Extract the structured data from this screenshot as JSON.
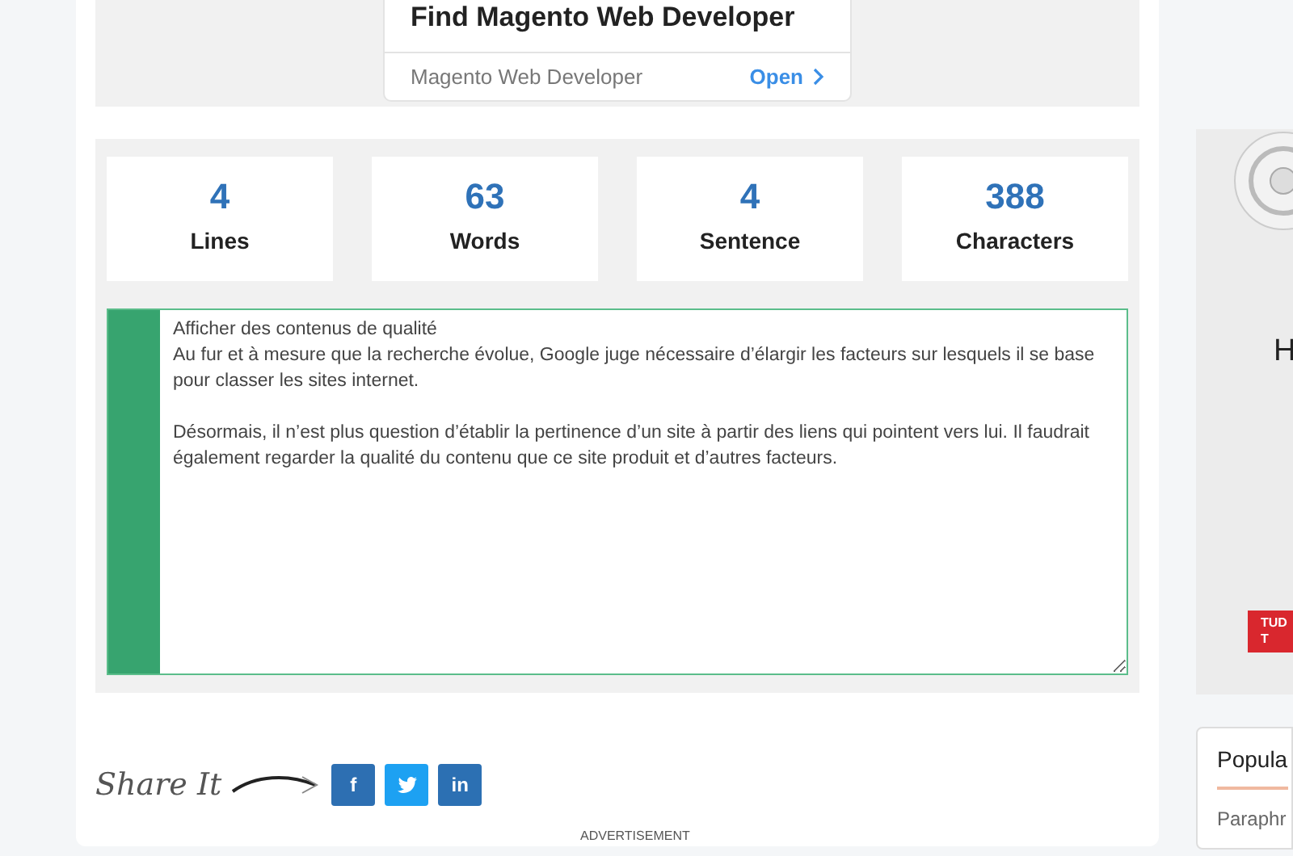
{
  "ad_card": {
    "title": "Find Magento Web Developer",
    "subtitle": "Magento Web Developer",
    "action": "Open"
  },
  "stats": [
    {
      "value": "4",
      "label": "Lines"
    },
    {
      "value": "63",
      "label": "Words"
    },
    {
      "value": "4",
      "label": "Sentence"
    },
    {
      "value": "388",
      "label": "Characters"
    }
  ],
  "editor": {
    "value": "Afficher des contenus de qualité\nAu fur et à mesure que la recherche évolue, Google juge nécessaire d’élargir les facteurs sur lesquels il se base pour classer les sites internet.\n\nDésormais, il n’est plus question d’établir la pertinence d’un site à partir des liens qui pointent vers lui. Il faudrait également regarder la qualité du contenu que ce site produit et d’autres facteurs."
  },
  "share": {
    "label": "Share It",
    "buttons": [
      {
        "kind": "facebook",
        "text": "f",
        "color": "#2d6fb2"
      },
      {
        "kind": "twitter",
        "color": "#1da1f2"
      },
      {
        "kind": "linkedin",
        "text": "in",
        "color": "#2c70b3"
      }
    ]
  },
  "advertisement_label": "ADVERTISEMENT",
  "sidebar": {
    "ad_heading": "H",
    "ad_button": [
      "TUD",
      "T"
    ],
    "popular": {
      "title": "Popula",
      "item": "Paraphr"
    }
  }
}
